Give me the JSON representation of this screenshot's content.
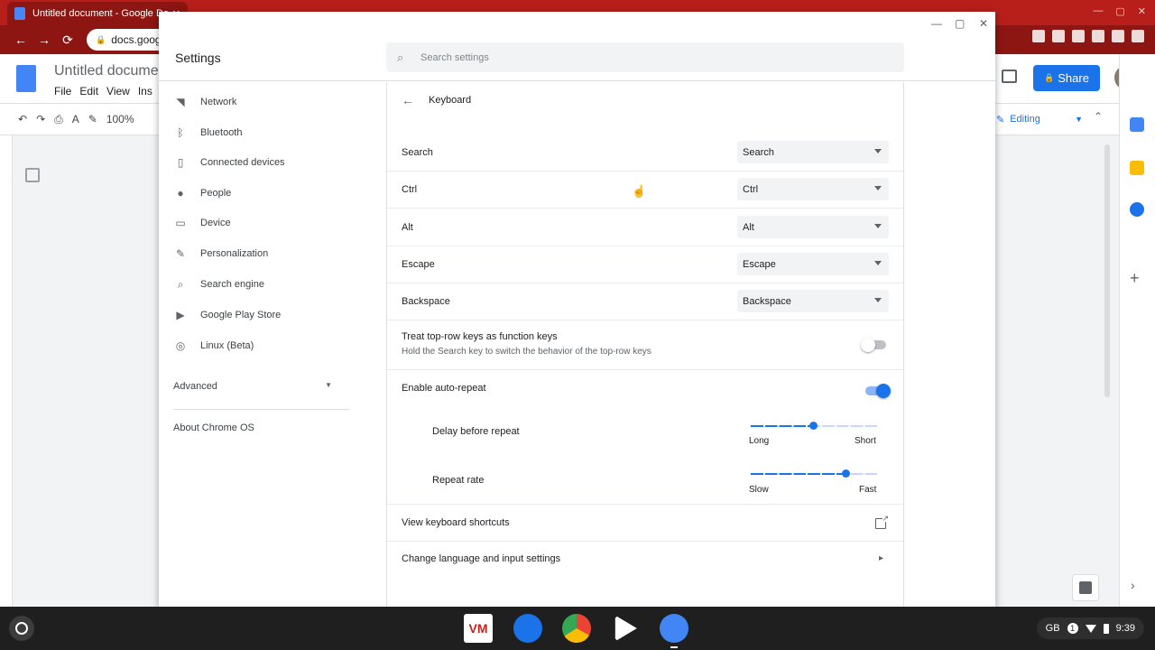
{
  "browser": {
    "tab_title": "Untitled document - Google Do",
    "tab_close": "✕",
    "url": "docs.goog",
    "window_controls": [
      "—",
      "▢",
      "✕"
    ]
  },
  "docs": {
    "title": "Untitled docume",
    "menu": [
      "File",
      "Edit",
      "View",
      "Ins"
    ],
    "zoom": "100%",
    "share_label": "Share",
    "editing_label": "Editing"
  },
  "settings": {
    "title": "Settings",
    "search_placeholder": "Search settings",
    "window_controls": [
      "—",
      "▢",
      "✕"
    ],
    "nav": [
      {
        "label": "Network",
        "icon": "wifi-icon"
      },
      {
        "label": "Bluetooth",
        "icon": "bluetooth-icon"
      },
      {
        "label": "Connected devices",
        "icon": "phone-icon"
      },
      {
        "label": "People",
        "icon": "person-icon"
      },
      {
        "label": "Device",
        "icon": "laptop-icon"
      },
      {
        "label": "Personalization",
        "icon": "pencil-icon"
      },
      {
        "label": "Search engine",
        "icon": "search-icon"
      },
      {
        "label": "Google Play Store",
        "icon": "play-store-icon"
      },
      {
        "label": "Linux (Beta)",
        "icon": "linux-icon"
      }
    ],
    "advanced": "Advanced",
    "about": "About Chrome OS",
    "page_title": "Keyboard",
    "key_mappings": [
      {
        "label": "Search",
        "value": "Search"
      },
      {
        "label": "Ctrl",
        "value": "Ctrl"
      },
      {
        "label": "Alt",
        "value": "Alt"
      },
      {
        "label": "Escape",
        "value": "Escape"
      },
      {
        "label": "Backspace",
        "value": "Backspace"
      }
    ],
    "function_keys": {
      "label": "Treat top-row keys as function keys",
      "sublabel": "Hold the Search key to switch the behavior of the top-row keys",
      "enabled": false
    },
    "auto_repeat": {
      "label": "Enable auto-repeat",
      "enabled": true
    },
    "delay": {
      "label": "Delay before repeat",
      "min_label": "Long",
      "max_label": "Short",
      "value": 0.5
    },
    "rate": {
      "label": "Repeat rate",
      "min_label": "Slow",
      "max_label": "Fast",
      "value": 0.75
    },
    "shortcuts_link": "View keyboard shortcuts",
    "language_link": "Change language and input settings"
  },
  "shelf": {
    "apps": [
      "VM",
      "Files",
      "Chrome",
      "Play Store",
      "Settings"
    ],
    "tray": {
      "layout": "GB",
      "notifications": "1",
      "time": "9:39"
    }
  },
  "colors": {
    "accent": "#1a73e8",
    "chrome_frame": "#b81f1a",
    "toggle_track_on": "#8ab4f8"
  }
}
